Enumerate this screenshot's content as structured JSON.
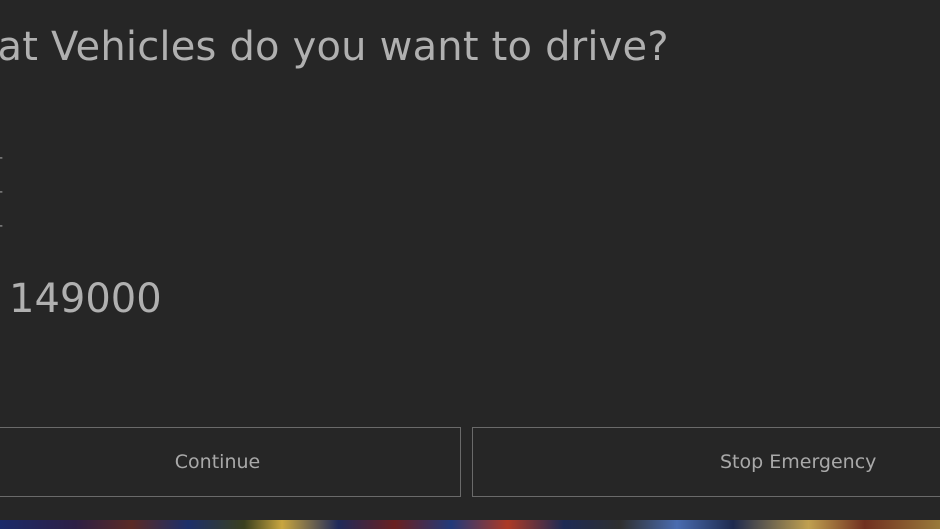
{
  "dialog": {
    "title": "hat Vehicles do you want to drive?",
    "vehicles": [
      {
        "label": "t -"
      },
      {
        "label": "t -"
      },
      {
        "label": "t -"
      }
    ],
    "amount": "149000",
    "buttons": {
      "continue_label": "Continue",
      "stop_label": "Stop Emergency"
    }
  },
  "colors": {
    "background": "#262626",
    "text": "#a9a9a9",
    "button_border": "#6a6a6a"
  }
}
